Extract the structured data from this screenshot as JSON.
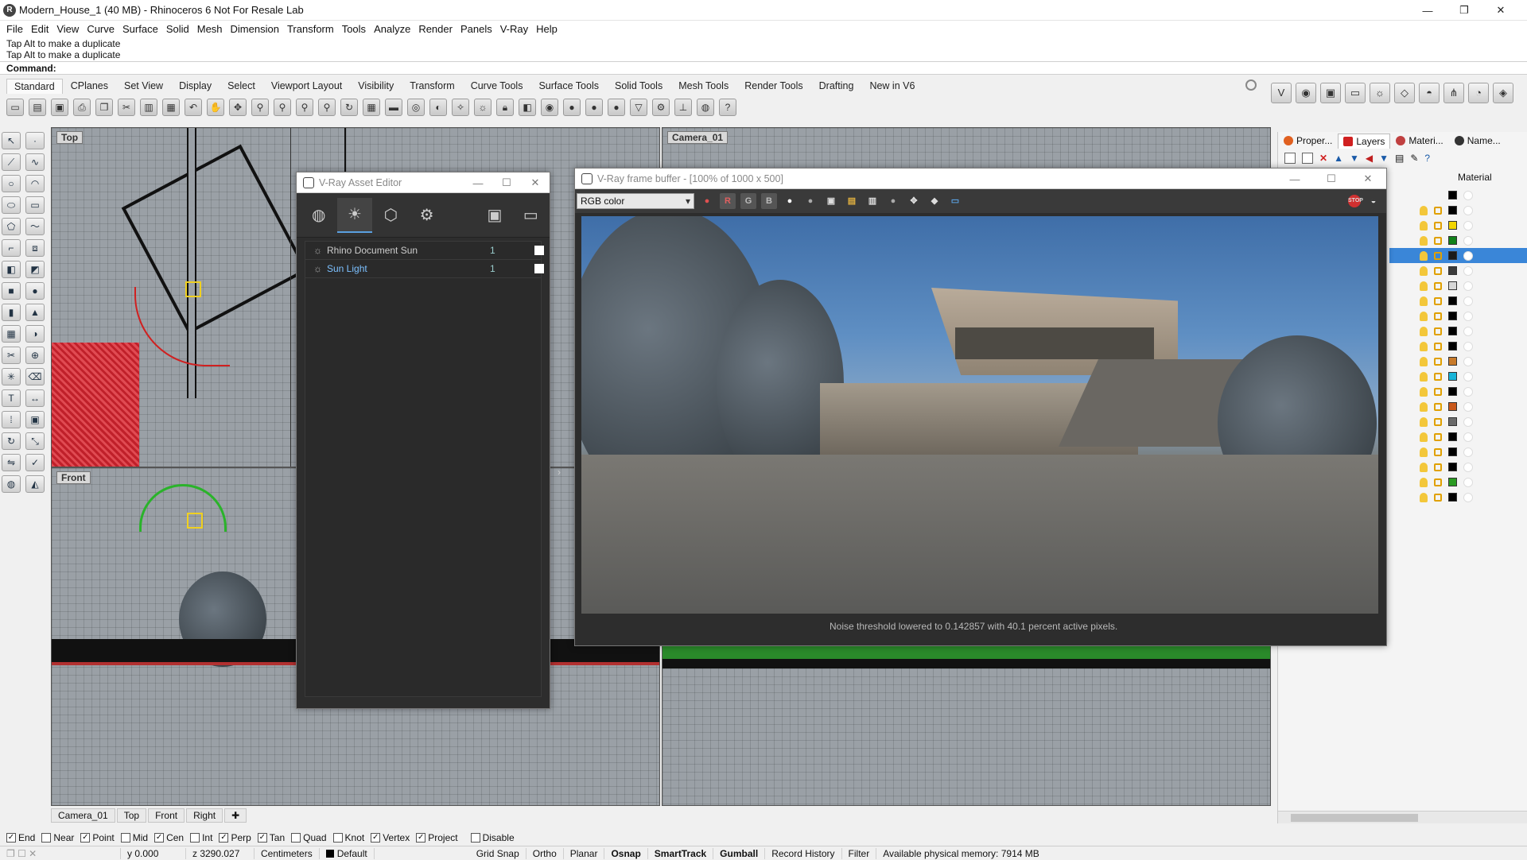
{
  "window": {
    "title": "Modern_House_1 (40 MB) - Rhinoceros 6 Not For Resale Lab",
    "min": "—",
    "max": "❐",
    "close": "✕"
  },
  "menu": [
    "File",
    "Edit",
    "View",
    "Curve",
    "Surface",
    "Solid",
    "Mesh",
    "Dimension",
    "Transform",
    "Tools",
    "Analyze",
    "Render",
    "Panels",
    "V-Ray",
    "Help"
  ],
  "command": {
    "history": [
      "Tap Alt to make a duplicate",
      "Tap Alt to make a duplicate"
    ],
    "prompt": "Command:"
  },
  "toolbar_tabs": [
    "Standard",
    "CPlanes",
    "Set View",
    "Display",
    "Select",
    "Viewport Layout",
    "Visibility",
    "Transform",
    "Curve Tools",
    "Surface Tools",
    "Solid Tools",
    "Mesh Tools",
    "Render Tools",
    "Drafting",
    "New in V6"
  ],
  "viewports": {
    "top": "Top",
    "front": "Front",
    "camera": "Camera_01"
  },
  "viewport_tabs": [
    "Camera_01",
    "Top",
    "Front",
    "Right"
  ],
  "asset_editor": {
    "title": "V-Ray Asset Editor",
    "items": [
      {
        "name": "Rhino Document Sun",
        "count": "1"
      },
      {
        "name": "Sun Light",
        "count": "1"
      }
    ]
  },
  "frame_buffer": {
    "title": "V-Ray frame buffer - [100% of 1000 x 500]",
    "channel": "RGB color",
    "r": "R",
    "g": "G",
    "b": "B",
    "status": "Noise threshold lowered to 0.142857 with 40.1 percent active pixels."
  },
  "panel": {
    "tabs": [
      "Proper...",
      "Layers",
      "Materi...",
      "Name..."
    ],
    "material_header": "Material",
    "swatches": [
      "#000000",
      "#000000",
      "#f2d500",
      "#11811a",
      "#1b1b1b",
      "#3b3b3b",
      "#d7d7d7",
      "#000000",
      "#000000",
      "#000000",
      "#000000",
      "#c87a2a",
      "#18b4d8",
      "#000000",
      "#c8571a",
      "#6a6a6a",
      "#000000",
      "#000000",
      "#000000",
      "#2a9a22",
      "#000000"
    ]
  },
  "osnap": [
    {
      "label": "End",
      "checked": true
    },
    {
      "label": "Near",
      "checked": false
    },
    {
      "label": "Point",
      "checked": true
    },
    {
      "label": "Mid",
      "checked": false
    },
    {
      "label": "Cen",
      "checked": true
    },
    {
      "label": "Int",
      "checked": false
    },
    {
      "label": "Perp",
      "checked": true
    },
    {
      "label": "Tan",
      "checked": true
    },
    {
      "label": "Quad",
      "checked": false
    },
    {
      "label": "Knot",
      "checked": false
    },
    {
      "label": "Vertex",
      "checked": true
    },
    {
      "label": "Project",
      "checked": true
    },
    {
      "label": "Disable",
      "checked": false
    }
  ],
  "status": {
    "y": "y 0.000",
    "z": "z 3290.027",
    "units": "Centimeters",
    "layer": "Default",
    "grid_snap": "Grid Snap",
    "ortho": "Ortho",
    "planar": "Planar",
    "osnap": "Osnap",
    "smarttrack": "SmartTrack",
    "gumball": "Gumball",
    "record_history": "Record History",
    "filter": "Filter",
    "memory": "Available physical memory: 7914 MB"
  }
}
